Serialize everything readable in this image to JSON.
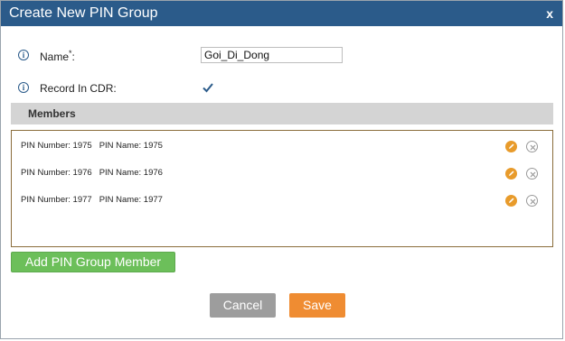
{
  "dialog": {
    "title": "Create New PIN Group",
    "close_label": "x"
  },
  "form": {
    "name_label": "Name",
    "name_required_mark": "*",
    "name_colon": ":",
    "name_value": "Goi_Di_Dong",
    "record_label": "Record In CDR:",
    "record_checked": true
  },
  "members": {
    "section_title": "Members",
    "rows": [
      {
        "number_text": "PIN Number: 1975",
        "name_text": "PIN Name: 1975"
      },
      {
        "number_text": "PIN Number: 1976",
        "name_text": "PIN Name: 1976"
      },
      {
        "number_text": "PIN Number: 1977",
        "name_text": "PIN Name: 1977"
      }
    ]
  },
  "actions": {
    "add_member_label": "Add PIN Group Member",
    "cancel_label": "Cancel",
    "save_label": "Save"
  },
  "icons": {
    "info": "info-icon",
    "edit": "pencil-icon",
    "delete": "close-circle-icon",
    "checkbox": "checkmark-icon"
  },
  "colors": {
    "title_bar": "#2b5b8a",
    "add_button": "#6cbf5a",
    "cancel_button": "#9d9d9d",
    "save_button": "#ef8c32",
    "edit_icon": "#e89b2b",
    "members_border": "#8a6d3b"
  }
}
